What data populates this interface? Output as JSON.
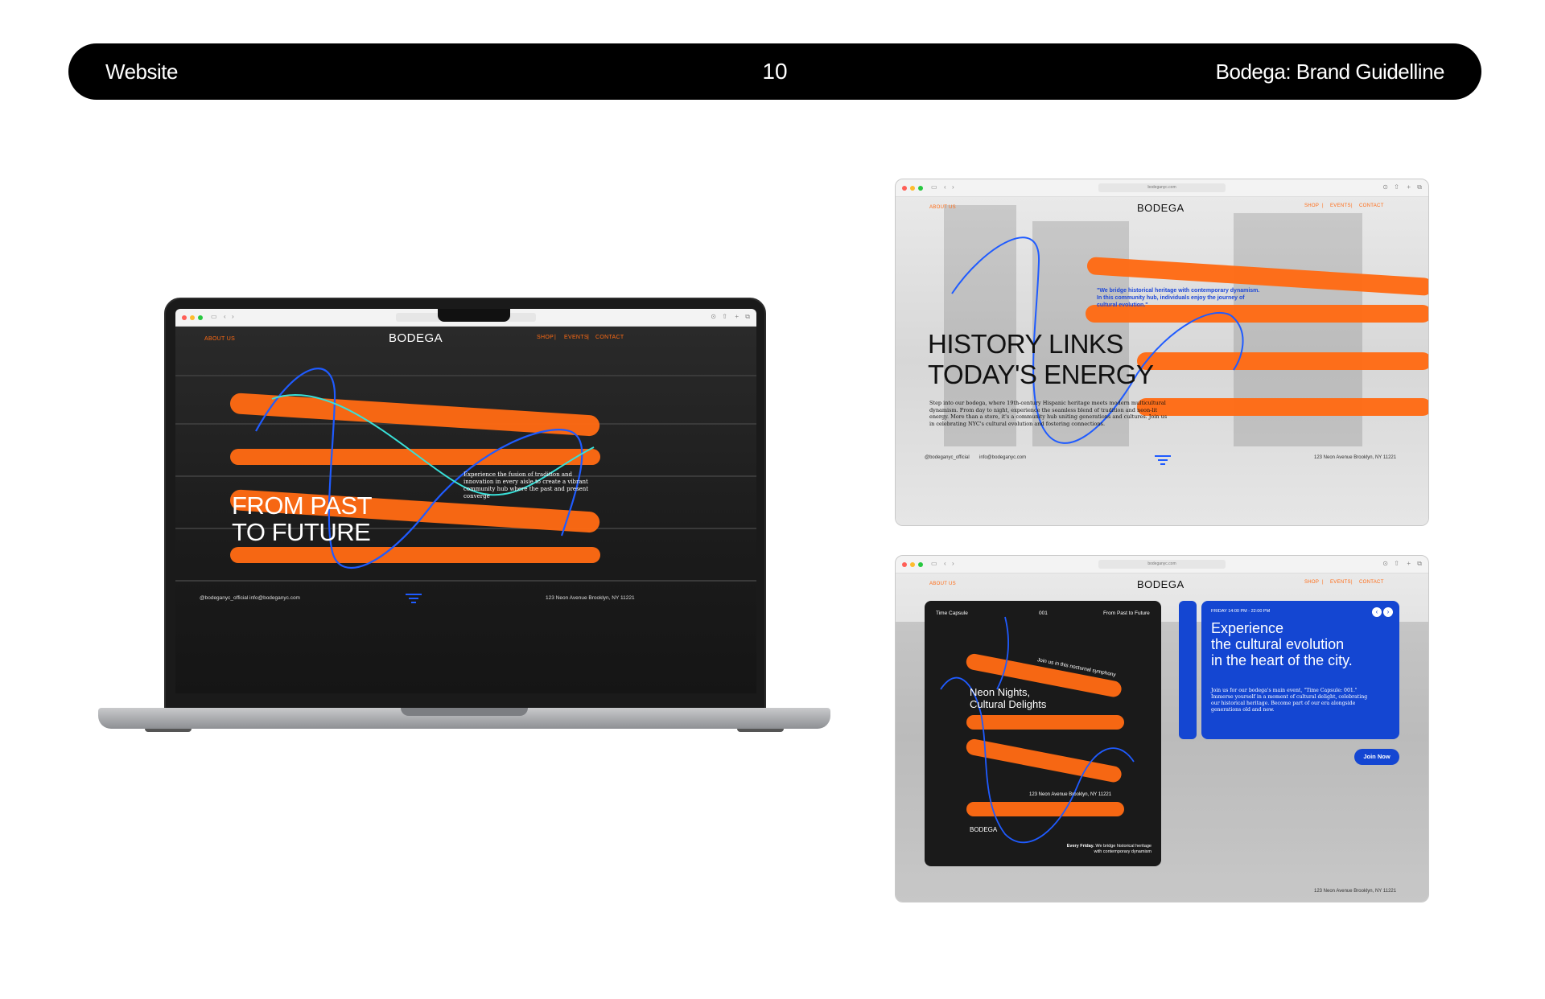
{
  "header": {
    "left": "Website",
    "page_number": "10",
    "right": "Bodega: Brand Guidelline"
  },
  "colors": {
    "orange": "#ff6a13",
    "blue": "#1446d2",
    "black": "#000000"
  },
  "browser": {
    "url": "bodeganyc.com",
    "traffic_lights": [
      "#ff5f57",
      "#febc2e",
      "#28c840"
    ]
  },
  "site": {
    "brand": "BODEGA",
    "nav_left": "ABOUT US",
    "nav_right": [
      "SHOP",
      "EVENTS",
      "CONTACT"
    ],
    "nav_sep": "|",
    "instagram": "@bodeganyc_official",
    "email": "info@bodeganyc.com",
    "address": "123 Neon Avenue Brooklyn, NY 11221"
  },
  "laptop_page": {
    "title_line1": "FROM PAST",
    "title_line2": "TO FUTURE",
    "blurb": "Experience the fusion of tradition and innovation in every aisle to create a vibrant community hub where the past and present converge"
  },
  "page_two": {
    "quote": "\"We bridge historical heritage with contemporary dynamism. In this community hub, individuals enjoy the journey of cultural evolution.\"",
    "title_line1": "HISTORY LINKS",
    "title_line2": "TODAY'S ENERGY",
    "body": "Step into our bodega, where 19th-century Hispanic heritage meets modern multicultural dynamism. From day to night, experience the seamless blend of tradition and neon-lit energy. More than a store, it's a community hub uniting generations and cultures. Join us in celebrating NYC's cultural evolution and fostering connections."
  },
  "page_three": {
    "poster": {
      "label_left": "Time Capsule",
      "label_center": "001",
      "label_right": "From Past to Future",
      "tagline": "Join us in this nocturnal symphony",
      "title_line1": "Neon Nights,",
      "title_line2": "Cultural Delights",
      "address": "123 Neon Avenue Brooklyn, NY 11221",
      "brand": "BODEGA",
      "footer_bold": "Every Friday.",
      "footer_rest": "We bridge historical heritage with contemporary dynamism"
    },
    "event": {
      "time": "FRIDAY 14:00 PM - 22:00 PM",
      "title_line1": "Experience",
      "title_line2": "the cultural evolution",
      "title_line3": "in the heart of the city.",
      "body": "Join us for our bodega's main event, \"Time Capsule: 001.\" Immerse yourself in a moment of cultural delight, celebrating our historical heritage. Become part of our era alongside generations old and new.",
      "button": "Join Now"
    }
  }
}
